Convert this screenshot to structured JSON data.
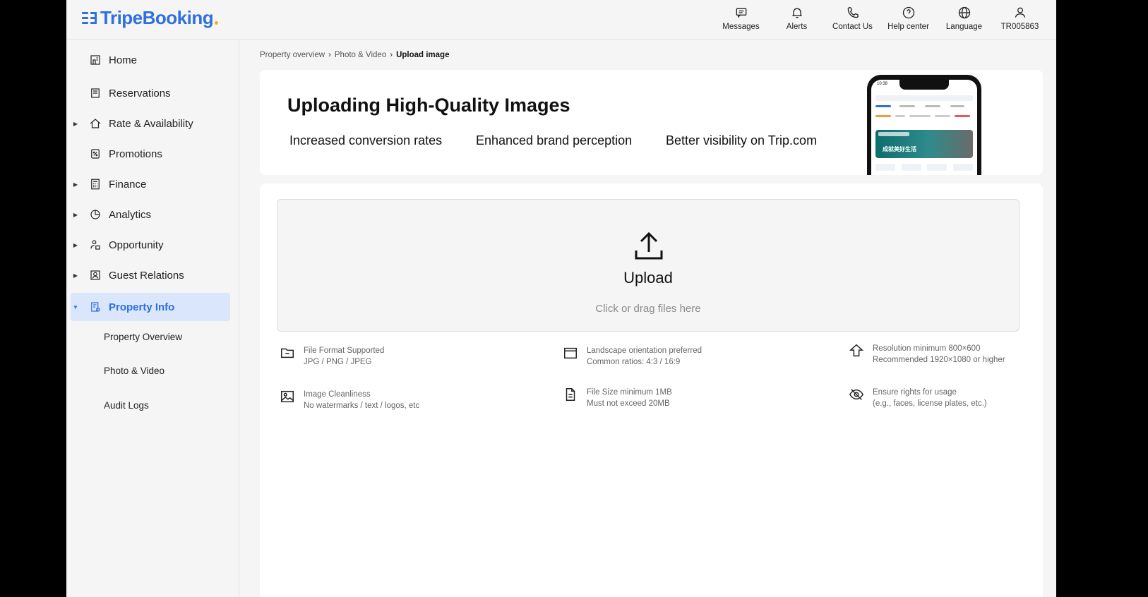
{
  "brand": {
    "name": "TripeBooking",
    "primary": "#2f6fe0",
    "accent": "#f5b400"
  },
  "header": {
    "actions": [
      {
        "label": "Messages",
        "icon": "messages-icon"
      },
      {
        "label": "Alerts",
        "icon": "bell-icon"
      },
      {
        "label": "Contact Us",
        "icon": "phone-icon"
      },
      {
        "label": "Help center",
        "icon": "help-icon"
      },
      {
        "label": "Language",
        "icon": "globe-icon"
      },
      {
        "label": "TR005863",
        "icon": "user-icon"
      }
    ]
  },
  "sidebar": {
    "items": [
      {
        "label": "Home",
        "icon": "home-icon",
        "expandable": false
      },
      {
        "label": "Reservations",
        "icon": "reservations-icon",
        "expandable": false
      },
      {
        "label": "Rate & Availability",
        "icon": "house-icon",
        "expandable": true
      },
      {
        "label": "Promotions",
        "icon": "promotion-icon",
        "expandable": false
      },
      {
        "label": "Finance",
        "icon": "calculator-icon",
        "expandable": true
      },
      {
        "label": "Analytics",
        "icon": "pie-chart-icon",
        "expandable": true
      },
      {
        "label": "Opportunity",
        "icon": "opportunity-icon",
        "expandable": true
      },
      {
        "label": "Guest Relations",
        "icon": "guest-icon",
        "expandable": true
      },
      {
        "label": "Property Info",
        "icon": "property-info-icon",
        "expandable": true,
        "active": true
      }
    ],
    "subitems": [
      {
        "label": "Property Overview"
      },
      {
        "label": "Photo & Video"
      },
      {
        "label": "Audit Logs"
      }
    ]
  },
  "breadcrumb": {
    "items": [
      "Property overview",
      "Photo & Video"
    ],
    "current": "Upload image",
    "separator": "›"
  },
  "banner": {
    "title": "Uploading High-Quality Images",
    "benefits": [
      "Increased conversion rates",
      "Enhanced brand perception",
      "Better visibility on Trip.com"
    ],
    "phone": {
      "time": "10:38",
      "hero_text": "成就美好生活"
    }
  },
  "upload": {
    "title": "Upload",
    "hint": "Click or drag files here"
  },
  "requirements": [
    {
      "icon": "folder-icon",
      "title": "File Format Supported",
      "detail": "JPG / PNG / JPEG"
    },
    {
      "icon": "landscape-icon",
      "title": "Landscape orientation preferred",
      "detail": "Common ratios: 4:3 / 16:9"
    },
    {
      "icon": "resolution-icon",
      "title": "Resolution minimum 800×600",
      "detail": "Recommended 1920×1080 or higher"
    },
    {
      "icon": "image-icon",
      "title": "Image Cleanliness",
      "detail": "No watermarks / text / logos, etc"
    },
    {
      "icon": "file-icon",
      "title": "File Size minimum 1MB",
      "detail": "Must not exceed 20MB"
    },
    {
      "icon": "eye-off-icon",
      "title": "Ensure rights for usage",
      "detail": "(e.g., faces, license plates, etc.)"
    }
  ]
}
